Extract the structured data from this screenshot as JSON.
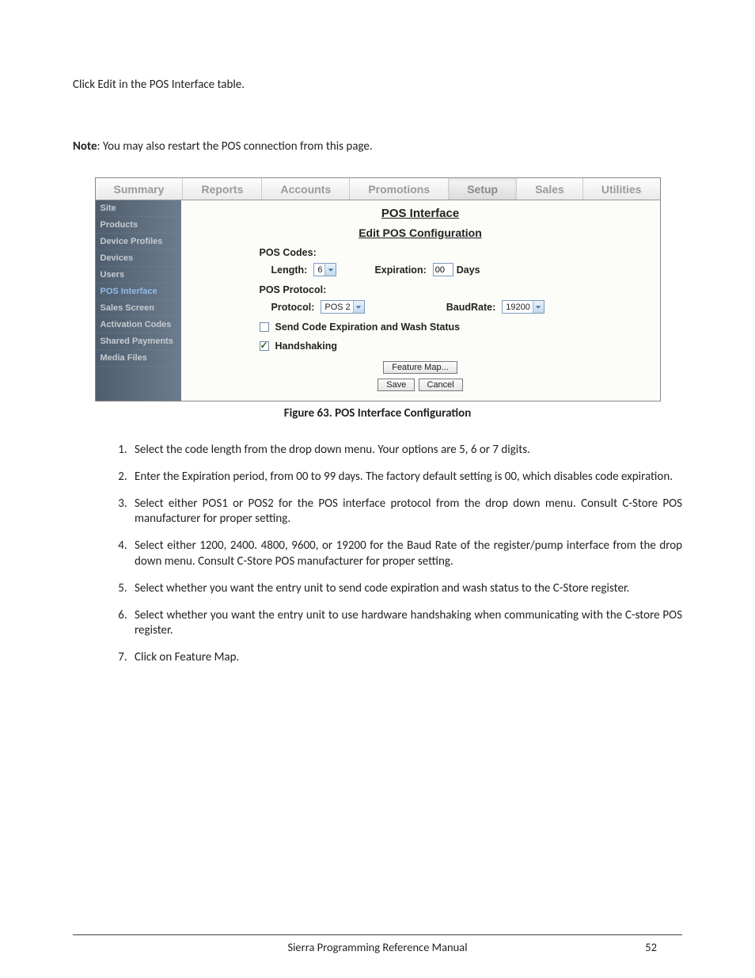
{
  "intro": "Click Edit in the POS Interface table.",
  "note_label": "Note",
  "note_text": ": You may also restart the POS connection from this page.",
  "tabs": [
    "Summary",
    "Reports",
    "Accounts",
    "Promotions",
    "Setup",
    "Sales",
    "Utilities"
  ],
  "active_tab_index": 4,
  "sidebar": {
    "items": [
      "Site",
      "Products",
      "Device Profiles",
      "Devices",
      "Users",
      "POS Interface",
      "Sales Screen",
      "Activation Codes",
      "Shared Payments",
      "Media Files"
    ],
    "active_index": 5
  },
  "panel": {
    "title": "POS Interface",
    "subtitle": "Edit POS Configuration",
    "pos_codes_label": "POS Codes:",
    "length_label": "Length:",
    "length_value": "6",
    "expiration_label": "Expiration:",
    "expiration_value": "00",
    "days_label": "Days",
    "pos_protocol_label": "POS Protocol:",
    "protocol_label": "Protocol:",
    "protocol_value": "POS 2",
    "baudrate_label": "BaudRate:",
    "baudrate_value": "19200",
    "send_code_label": "Send Code Expiration and Wash Status",
    "handshaking_label": "Handshaking",
    "feature_map_btn": "Feature Map...",
    "save_btn": "Save",
    "cancel_btn": "Cancel"
  },
  "figure_caption": "Figure 63. POS Interface Configuration",
  "steps": [
    "Select the code length from the drop down menu. Your options are 5, 6 or 7 digits.",
    "Enter the Expiration period, from 00 to 99 days. The factory default setting is 00, which disables code expiration.",
    "Select either POS1 or POS2 for the POS interface protocol from the drop down menu. Consult C-Store POS manufacturer for proper setting.",
    "Select either 1200, 2400. 4800, 9600, or 19200 for the Baud Rate of the register/pump interface from the drop down menu. Consult C-Store POS manufacturer for proper setting.",
    "Select whether you want the entry unit to send code expiration and wash status to the C-Store register.",
    "Select whether you want the entry unit to use hardware handshaking when communicating with the C-store POS register.",
    "Click on Feature Map."
  ],
  "footer": {
    "title": "Sierra Programming Reference Manual",
    "page": "52"
  }
}
